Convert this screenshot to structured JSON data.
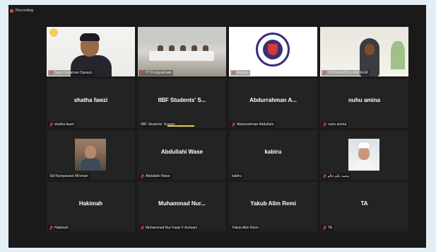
{
  "recording": {
    "label": "Recording"
  },
  "tiles": [
    {
      "kind": "video-host",
      "label": "Saleh Sulaiman Danazo",
      "muted": true,
      "active": false
    },
    {
      "kind": "video-room",
      "label": "IIT Postgraduate",
      "muted": true,
      "active": true
    },
    {
      "kind": "video-logo",
      "label": "Alamgir",
      "muted": true,
      "active": false
    },
    {
      "kind": "video-lady",
      "label": "FATIMA ABDULRAHEEM",
      "muted": true,
      "active": false
    },
    {
      "kind": "name",
      "name": "shatha fawzi",
      "label": "shatha fawzi",
      "muted": true,
      "active": false
    },
    {
      "kind": "name",
      "name": "IIBF Students' S...",
      "label": "IIBF Students' Society",
      "muted": false,
      "active": false,
      "speaking": true
    },
    {
      "kind": "name",
      "name": "Abdurrahman A...",
      "label": "Abdurrahman Abdullahi",
      "muted": true,
      "active": false
    },
    {
      "kind": "name",
      "name": "nuhu amina",
      "label": "nuhu amina",
      "muted": true,
      "active": false
    },
    {
      "kind": "photo1",
      "label": "Siti Nursyawani Mi'oman",
      "muted": false,
      "active": false
    },
    {
      "kind": "name",
      "name": "Abdullahi Wase",
      "label": "Abdullahi Wase",
      "muted": true,
      "active": false
    },
    {
      "kind": "name",
      "name": "kabiru",
      "label": "kabiru",
      "muted": false,
      "active": false
    },
    {
      "kind": "photo2",
      "label": "محمد بللو جالو",
      "muted": true,
      "active": false
    },
    {
      "kind": "name",
      "name": "Hakimah",
      "label": "Hakimah",
      "muted": true,
      "active": false
    },
    {
      "kind": "name",
      "name": "Muhammad Nur...",
      "label": "Muhammad Nur Faaiz F Achsani",
      "muted": true,
      "active": false
    },
    {
      "kind": "name",
      "name": "Yakub Alim Remi",
      "label": "Yakub Alim Remi",
      "muted": false,
      "active": false
    },
    {
      "kind": "name",
      "name": "TA",
      "label": "TA",
      "muted": true,
      "active": false
    }
  ],
  "colors": {
    "background": "#e4eef5",
    "video_area": "#1a1a1a",
    "tile": "#232323",
    "active_border": "#c7e03a",
    "mute_red": "#e04b3b",
    "speaking_bar": "#e6c84a"
  }
}
